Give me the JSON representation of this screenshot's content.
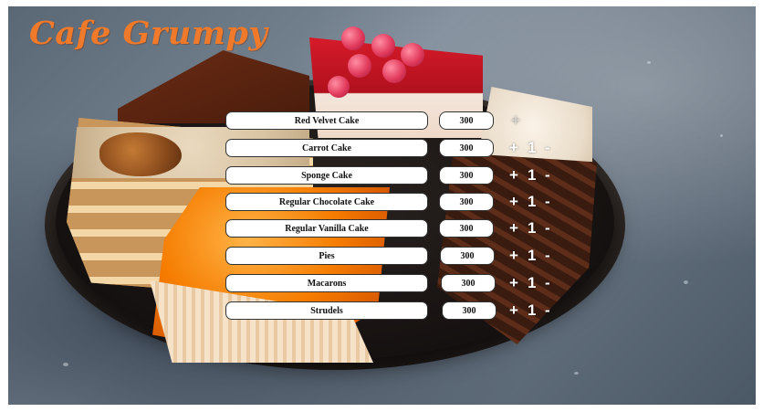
{
  "brand": {
    "title": "Cafe Grumpy",
    "color": "#f07a2a"
  },
  "menu": {
    "items": [
      {
        "name": "Red Velvet Cake",
        "price": "300",
        "plus": "+",
        "qty": "",
        "minus": ""
      },
      {
        "name": "Carrot Cake",
        "price": "300",
        "plus": "+",
        "qty": "1",
        "minus": "-"
      },
      {
        "name": "Sponge Cake",
        "price": "300",
        "plus": "+",
        "qty": "1",
        "minus": "-"
      },
      {
        "name": "Regular Chocolate Cake",
        "price": "300",
        "plus": "+",
        "qty": "1",
        "minus": "-"
      },
      {
        "name": "Regular Vanilla Cake",
        "price": "300",
        "plus": "+",
        "qty": "1",
        "minus": "-"
      },
      {
        "name": "Pies",
        "price": "300",
        "plus": "+",
        "qty": "1",
        "minus": "-"
      },
      {
        "name": "Macarons",
        "price": "300",
        "plus": "+",
        "qty": "1",
        "minus": "-"
      },
      {
        "name": "Strudels",
        "price": "300",
        "plus": "+",
        "qty": "1",
        "minus": "-"
      }
    ]
  }
}
